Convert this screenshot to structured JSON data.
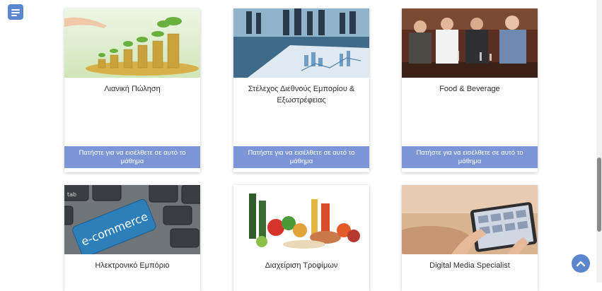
{
  "menu": {
    "icon": "menu-lines-icon"
  },
  "courses": [
    {
      "title": "Λιανική Πώληση",
      "cta": "Πατήστε για να εισέλθετε σε αυτό το μάθημα",
      "image": "coins-plants-image"
    },
    {
      "title": "Στέλεχος Διεθνούς Εμπορίου & Εξωστρέφειας",
      "cta": "Πατήστε για να εισέλθετε σε αυτό το μάθημα",
      "image": "business-meeting-image"
    },
    {
      "title": "Food & Beverage",
      "cta": "Πατήστε για να εισέλθετε σε αυτό το μάθημα",
      "image": "restaurant-staff-image"
    },
    {
      "title": "Ηλεκτρονικό Εμπόριο",
      "image": "ecommerce-keyboard-image"
    },
    {
      "title": "Διαχείριση Τροφίμων",
      "image": "groceries-image"
    },
    {
      "title": "Digital Media Specialist",
      "image": "tablet-hands-image"
    }
  ],
  "scroll_top": {
    "icon": "chevron-up-icon"
  },
  "colors": {
    "accent": "#5b86cf",
    "cta": "#7c95d6"
  }
}
